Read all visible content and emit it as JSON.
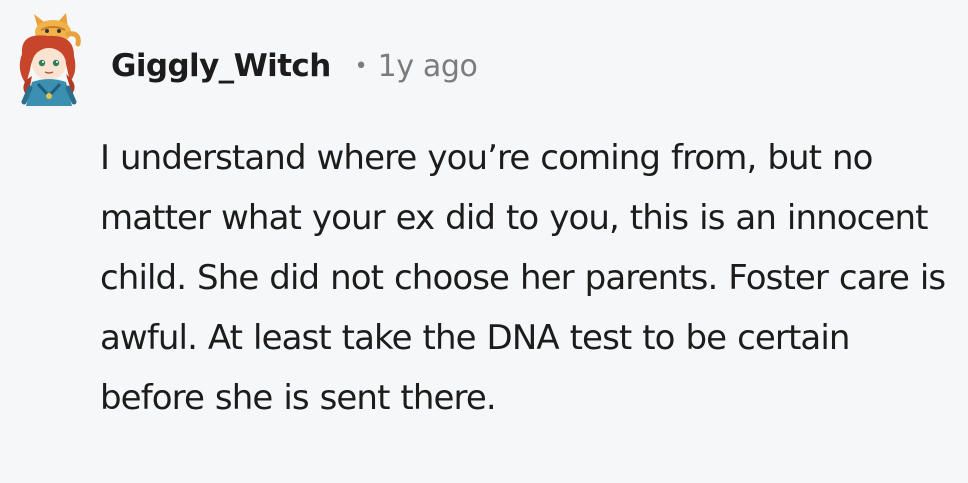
{
  "comment": {
    "author": "Giggly_Witch",
    "separator": "•",
    "timestamp": "1y ago",
    "body": "I understand where you’re coming from, but no matter what your ex did to you, this is an innocent child. She did not choose her parents. Foster care is awful. At least take the DNA test to be certain before she is sent there.",
    "avatar_icon": "redhead-character-with-cat-avatar-icon"
  },
  "colors": {
    "background": "#f6f7f8",
    "text": "#1c1c1c",
    "meta": "#7c7c7c"
  }
}
